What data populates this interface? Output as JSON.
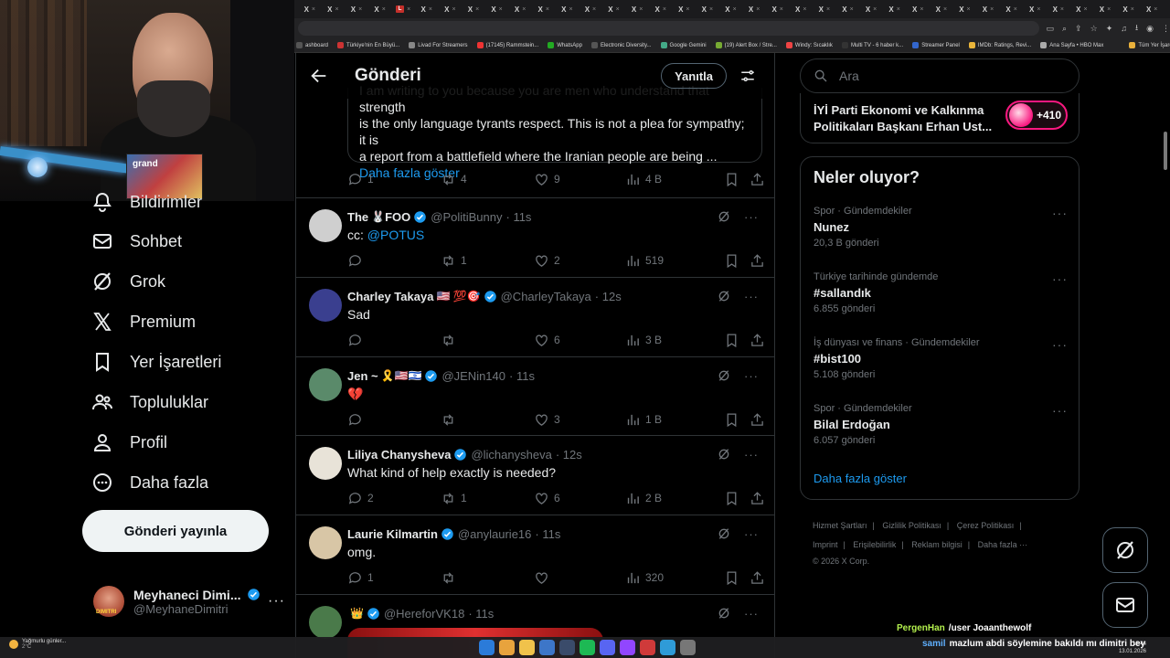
{
  "browser": {
    "tab_glyphs": [
      "X",
      "X",
      "X",
      "X",
      "L",
      "X",
      "X",
      "X",
      "X",
      "X",
      "X",
      "X",
      "X",
      "X",
      "X",
      "X",
      "X",
      "X",
      "X",
      "X",
      "X",
      "X",
      "X",
      "X",
      "X",
      "X",
      "X",
      "X",
      "X",
      "X",
      "X",
      "X",
      "X",
      "X",
      "X",
      "X",
      "X"
    ],
    "bookmarks": [
      "ashboard",
      "Türkiye'nin En Büyü...",
      "Livad For Streamers",
      "(17145) Rammstein...",
      "WhatsApp",
      "Electronic Diversity...",
      "Google Gemini",
      "(19) Alert Box / Stre...",
      "Windy: Sıcaklık",
      "Multi TV - 6 haber k...",
      "Streamer Panel",
      "IMDb: Ratings, Revi...",
      "Ana Sayfa • HBO Max",
      "Tüm Yer İşaretleri"
    ]
  },
  "webcam": {
    "book_text": "grand"
  },
  "sidebar": {
    "items": [
      {
        "label": "Bildirimler",
        "icon": "bell-icon"
      },
      {
        "label": "Sohbet",
        "icon": "mail-icon"
      },
      {
        "label": "Grok",
        "icon": "grok-icon"
      },
      {
        "label": "Premium",
        "icon": "x-logo-icon"
      },
      {
        "label": "Yer İşaretleri",
        "icon": "bookmark-icon"
      },
      {
        "label": "Topluluklar",
        "icon": "people-icon"
      },
      {
        "label": "Profil",
        "icon": "person-icon"
      },
      {
        "label": "Daha fazla",
        "icon": "more-circle-icon"
      }
    ],
    "post_button": "Gönderi yayınla",
    "account": {
      "name": "Meyhaneci Dimi...",
      "handle": "@MeyhaneDimitri",
      "avatar_text": "DIMITRI"
    }
  },
  "header": {
    "title": "Gönderi",
    "reply_button": "Yanıtla"
  },
  "quote": {
    "line1": "I am writing to you because you are men who understand that strength",
    "line2": "is the only language tyrants respect. This is not a plea for sympathy; it is",
    "line3": "a report from a battlefield where the Iranian people are being ...",
    "show_more": "Daha fazla göster"
  },
  "main_post_stats": {
    "replies": "1",
    "reposts": "4",
    "likes": "9",
    "views": "4 B"
  },
  "replies": [
    {
      "name": "The",
      "name_emoji": "🐰",
      "name_suffix": "FOO",
      "handle": "@PolitiBunny",
      "time": "· 11s",
      "text": "cc: ",
      "mention": "@POTUS",
      "replies": "",
      "reposts": "1",
      "likes": "2",
      "views": "519",
      "avatar_color": "#cfcfcf"
    },
    {
      "name": "Charley Takaya",
      "name_emoji": "🇺🇸 💯🎯",
      "name_suffix": "",
      "handle": "@CharleyTakaya",
      "time": "· 12s",
      "text": "Sad",
      "mention": "",
      "replies": "",
      "reposts": "",
      "likes": "6",
      "views": "3 B",
      "avatar_color": "#3a3f8f"
    },
    {
      "name": "Jen ~",
      "name_emoji": "🎗️🇺🇸🇮🇱",
      "name_suffix": "",
      "handle": "@JENin140",
      "time": "· 11s",
      "text": "💔",
      "mention": "",
      "replies": "",
      "reposts": "",
      "likes": "3",
      "views": "1 B",
      "avatar_color": "#5a8a6a"
    },
    {
      "name": "Liliya Chanysheva",
      "name_emoji": "",
      "name_suffix": "",
      "handle": "@lichanysheva",
      "time": "· 12s",
      "text": "What kind of help exactly is needed?",
      "mention": "",
      "replies": "2",
      "reposts": "1",
      "likes": "6",
      "views": "2 B",
      "avatar_color": "#e8e3d8"
    },
    {
      "name": "Laurie Kilmartin",
      "name_emoji": "",
      "name_suffix": "",
      "handle": "@anylaurie16",
      "time": "· 11s",
      "text": "omg.",
      "mention": "",
      "replies": "1",
      "reposts": "",
      "likes": "",
      "views": "320",
      "avatar_color": "#d8c6a6"
    },
    {
      "name": "",
      "name_emoji": "👑",
      "name_suffix": "",
      "handle": "@HereforVK18",
      "time": "· 11s",
      "text": "",
      "mention": "",
      "replies": "",
      "reposts": "",
      "likes": "",
      "views": "",
      "avatar_color": "#4a7a4a"
    }
  ],
  "right": {
    "search_placeholder": "Ara",
    "top_card_line1": "İYİ Parti Ekonomi ve Kalkınma",
    "top_card_line2": "Politikaları Başkanı Erhan Ust...",
    "top_card_badge": "+410",
    "trends_title": "Neler oluyor?",
    "trends": [
      {
        "context": "Spor · Gündemdekiler",
        "title": "Nunez",
        "count": "20,3 B gönderi"
      },
      {
        "context": "Türkiye tarihinde gündemde",
        "title": "#sallandık",
        "count": "6.855 gönderi"
      },
      {
        "context": "İş dünyası ve finans · Gündemdekiler",
        "title": "#bist100",
        "count": "5.108 gönderi"
      },
      {
        "context": "Spor · Gündemdekiler",
        "title": "Bilal Erdoğan",
        "count": "6.057 gönderi"
      }
    ],
    "show_more": "Daha fazla göster",
    "footer_row1": [
      "Hizmet Şartları",
      "Gizlilik Politikası",
      "Çerez Politikası"
    ],
    "footer_row2": [
      "Imprint",
      "Erişilebilirlik",
      "Reklam bilgisi",
      "Daha fazla ···"
    ],
    "copyright": "© 2026 X Corp."
  },
  "chat": [
    {
      "user": "PergenHan",
      "message": "/user Joaanthewolf"
    },
    {
      "user": "samil",
      "message": "mazlum abdi söylemine bakıldı mı dimitri bey"
    }
  ],
  "taskbar": {
    "weather": "Yağmurlu günler...",
    "temp": "2°C",
    "time": "13:44",
    "date": "13.01.2026"
  },
  "colors": {
    "accent": "#1d9bf0",
    "like_pink": "#f91880",
    "verified": "#1d9bf0",
    "chat_user1": "#b3f04d",
    "chat_user2": "#5fb0ff"
  }
}
